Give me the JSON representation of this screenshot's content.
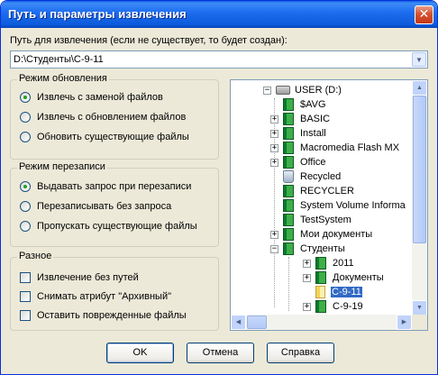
{
  "window": {
    "title": "Путь и параметры извлечения"
  },
  "path": {
    "label": "Путь для извлечения (если не существует, то будет создан):",
    "value": "D:\\Студенты\\С-9-11"
  },
  "update_mode": {
    "legend": "Режим обновления",
    "options": [
      {
        "label": "Извлечь с заменой файлов",
        "selected": true
      },
      {
        "label": "Извлечь с обновлением файлов",
        "selected": false
      },
      {
        "label": "Обновить существующие файлы",
        "selected": false
      }
    ]
  },
  "overwrite_mode": {
    "legend": "Режим перезаписи",
    "options": [
      {
        "label": "Выдавать запрос при перезаписи",
        "selected": true
      },
      {
        "label": "Перезаписывать без запроса",
        "selected": false
      },
      {
        "label": "Пропускать существующие файлы",
        "selected": false
      }
    ]
  },
  "misc": {
    "legend": "Разное",
    "options": [
      {
        "label": "Извлечение без путей",
        "checked": false
      },
      {
        "label": "Снимать атрибут \"Архивный\"",
        "checked": false
      },
      {
        "label": "Оставить поврежденные файлы",
        "checked": false
      }
    ]
  },
  "tree": {
    "nodes": [
      {
        "label": "USER (D:)",
        "icon": "drive-icon",
        "expander": "−"
      },
      {
        "label": "$AVG",
        "icon": "folder-icon",
        "expander": ""
      },
      {
        "label": "BASIC",
        "icon": "folder-icon",
        "expander": "+"
      },
      {
        "label": "Install",
        "icon": "folder-icon",
        "expander": "+"
      },
      {
        "label": "Macromedia Flash MX",
        "icon": "folder-icon",
        "expander": "+"
      },
      {
        "label": "Office",
        "icon": "folder-icon",
        "expander": "+"
      },
      {
        "label": "Recycled",
        "icon": "recycle-bin-icon",
        "expander": ""
      },
      {
        "label": "RECYCLER",
        "icon": "folder-icon",
        "expander": ""
      },
      {
        "label": "System Volume Informa",
        "icon": "folder-icon",
        "expander": ""
      },
      {
        "label": "TestSystem",
        "icon": "folder-icon",
        "expander": ""
      },
      {
        "label": "Мои документы",
        "icon": "folder-icon",
        "expander": "+"
      },
      {
        "label": "Студенты",
        "icon": "folder-icon",
        "expander": "−"
      },
      {
        "label": "2011",
        "icon": "folder-icon",
        "expander": "+"
      },
      {
        "label": "Документы",
        "icon": "folder-icon",
        "expander": "+"
      },
      {
        "label": "С-9-11",
        "icon": "open-folder-icon",
        "expander": "",
        "selected": true
      },
      {
        "label": "С-9-19",
        "icon": "folder-icon",
        "expander": "+"
      }
    ]
  },
  "buttons": {
    "ok": "OK",
    "cancel": "Отмена",
    "help": "Справка"
  }
}
